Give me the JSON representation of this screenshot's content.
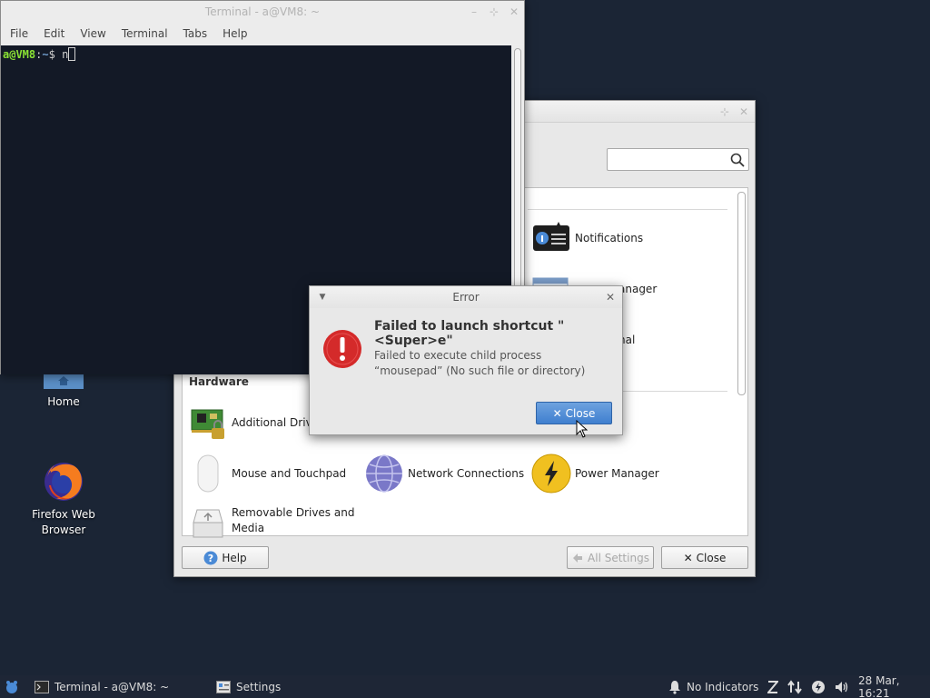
{
  "desktop": {
    "icons": [
      {
        "label": "Home",
        "icon": "home-folder-icon"
      },
      {
        "label": "Firefox Web Browser",
        "icon": "firefox-icon"
      }
    ]
  },
  "settings_window": {
    "title": "",
    "search": {
      "placeholder": "",
      "value": ""
    },
    "partial_items": [
      {
        "label": "Notifications",
        "icon": "notifications-icon"
      },
      {
        "label": "anager",
        "icon": "window-manager-icon"
      },
      {
        "label": "nal",
        "icon": "terminal-icon"
      }
    ],
    "hardware": {
      "heading": "Hardware",
      "items": [
        {
          "label": "Additional Drivers",
          "icon": "additional-drivers-icon"
        },
        {
          "label": "Mouse and Touchpad",
          "icon": "mouse-icon"
        },
        {
          "label": "Network Connections",
          "icon": "network-icon"
        },
        {
          "label": "Power Manager",
          "icon": "power-icon"
        },
        {
          "label": "Removable Drives and Media",
          "icon": "removable-drives-icon"
        }
      ]
    },
    "buttons": {
      "help": "Help",
      "all_settings": "All Settings",
      "close": "Close"
    }
  },
  "terminal": {
    "title": "Terminal - a@VM8: ~",
    "menu": [
      "File",
      "Edit",
      "View",
      "Terminal",
      "Tabs",
      "Help"
    ],
    "prompt_user": "a@VM8",
    "prompt_sep": ":",
    "prompt_path": "~",
    "prompt_symbol": "$",
    "input": "n"
  },
  "error_dialog": {
    "title": "Error",
    "heading": "Failed to launch shortcut \"<Super>e\"",
    "message_line1": "Failed to execute child process",
    "message_line2": "“mousepad” (No such file or directory)",
    "close_label": "Close"
  },
  "taskbar": {
    "tasks": [
      {
        "label": "Terminal - a@VM8: ~",
        "icon": "terminal-icon"
      },
      {
        "label": "Settings",
        "icon": "settings-icon"
      }
    ],
    "indicators_label": "No Indicators",
    "clock": "28 Mar, 16:21"
  },
  "colors": {
    "desktop_bg": "#1b2535",
    "terminal_bg": "#131926",
    "prompt_user": "#8ae234",
    "prompt_path": "#729fcf",
    "accent": "#3f7fcf",
    "error_red": "#d42a2a"
  }
}
